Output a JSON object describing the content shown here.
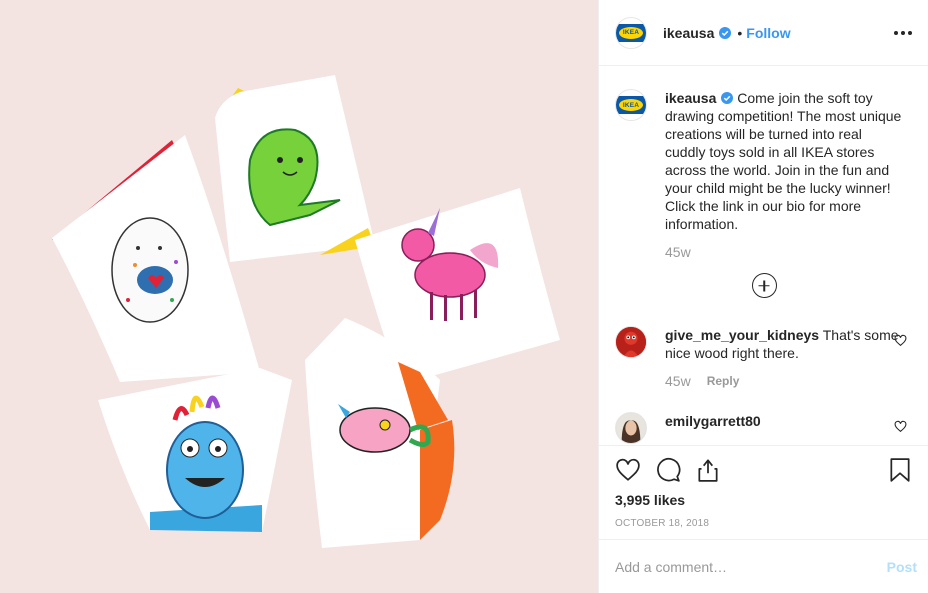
{
  "post": {
    "author": "ikeausa",
    "follow_label": "Follow",
    "separator": "•",
    "logo_text": "IKEA",
    "caption": "Come join the soft toy drawing competition! The most unique creations will be turned into real cuddly toys sold in all IKEA stores across the world. Join in the fun and your child might be the lucky winner! Click the link in our bio for more information.",
    "caption_age": "45w",
    "likes": "3,995 likes",
    "date": "OCTOBER 18, 2018"
  },
  "comments": [
    {
      "user": "give_me_your_kidneys",
      "text": "That's some nice wood right there.",
      "age": "45w",
      "reply_label": "Reply"
    },
    {
      "user": "emilygarrett80",
      "text": ""
    }
  ],
  "composer": {
    "placeholder": "Add a comment…",
    "post_label": "Post"
  },
  "colors": {
    "link_blue": "#3897f0",
    "verified_blue": "#3897f0",
    "ikea_blue": "#0a58a6",
    "ikea_yellow": "#ffd400",
    "photo_background": "#f3e3e1"
  },
  "icons": {
    "like": "heart-icon",
    "comment": "comment-icon",
    "share": "share-icon",
    "save": "bookmark-icon",
    "more": "more-options-icon",
    "verified": "verified-badge-icon",
    "load_more": "plus-circle-icon"
  }
}
